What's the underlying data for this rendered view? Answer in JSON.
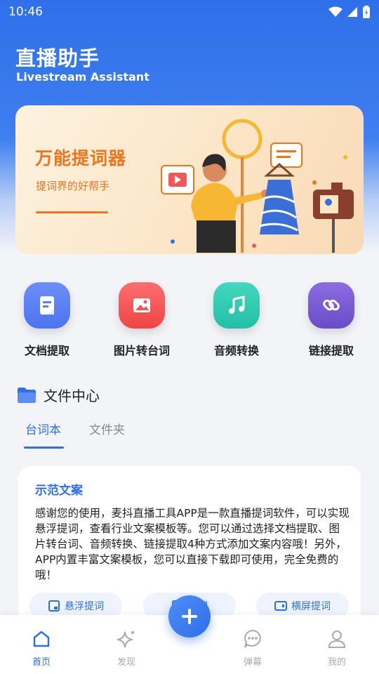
{
  "status_bar": {
    "time": "10:46"
  },
  "header": {
    "title": "直播助手",
    "subtitle": "Livestream Assistant"
  },
  "banner": {
    "title": "万能提词器",
    "subtitle": "提词界的好帮手"
  },
  "features": [
    {
      "label": "文档提取",
      "icon": "document-icon",
      "color": "#5b7ff5"
    },
    {
      "label": "图片转台词",
      "icon": "image-icon",
      "color": "#f45656"
    },
    {
      "label": "音频转换",
      "icon": "music-icon",
      "color": "#2ec9b0"
    },
    {
      "label": "链接提取",
      "icon": "link-icon",
      "color": "#7a5ad6"
    }
  ],
  "file_center": {
    "title": "文件中心",
    "tabs": [
      {
        "label": "台词本",
        "active": true
      },
      {
        "label": "文件夹",
        "active": false
      }
    ]
  },
  "sample_card": {
    "title": "示范文案",
    "body": "感谢您的使用，麦抖直播工具APP是一款直播提词软件，可以实现悬浮提词，查看行业文案模板等。您可以通过选择文档提取、图片转台词、音频转换、链接提取4种方式添加文案内容哦！另外，APP内置丰富文案模板，您可以直接下载即可使用，完全免费的哦！",
    "actions": [
      "悬浮提词",
      "提词",
      "横屏提词"
    ]
  },
  "bottom_nav": [
    {
      "label": "首页",
      "icon": "home-icon",
      "active": true
    },
    {
      "label": "发现",
      "icon": "sparkle-icon",
      "active": false
    },
    {
      "label": "弹幕",
      "icon": "chat-bubble-icon",
      "active": false
    },
    {
      "label": "我的",
      "icon": "user-icon",
      "active": false
    }
  ],
  "colors": {
    "accent": "#2f6fe9",
    "banner_text": "#f0741b"
  }
}
